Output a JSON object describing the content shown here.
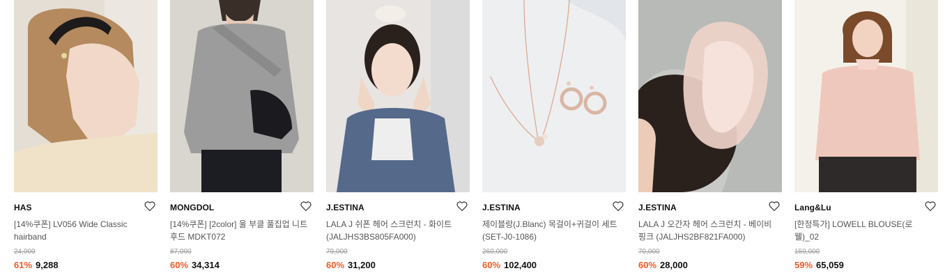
{
  "colors": {
    "discount": "#ef5b24",
    "text": "#111111",
    "muted": "#555555",
    "strike": "#999999"
  },
  "products": [
    {
      "brand": "HAS",
      "name": "[14%쿠폰] LV056 Wide Classic hairband",
      "original_price": "24,000",
      "discount_rate": "61%",
      "price": "9,288",
      "wishlist_icon": "heart-outline-icon"
    },
    {
      "brand": "MONGDOL",
      "name": "[14%쿠폰] [2color] 울 부클 풀집업 니트후드 MDKT072",
      "original_price": "87,000",
      "discount_rate": "60%",
      "price": "34,314",
      "wishlist_icon": "heart-outline-icon"
    },
    {
      "brand": "J.ESTINA",
      "name": "LALA J 쉬폰 헤어 스크런치 - 화이트 (JALJHS3BS805FA000)",
      "original_price": "79,000",
      "discount_rate": "60%",
      "price": "31,200",
      "wishlist_icon": "heart-outline-icon"
    },
    {
      "brand": "J.ESTINA",
      "name": "제이블랑(J.Blanc) 목걸이+귀걸이 세트 (SET-J0-1086)",
      "original_price": "260,000",
      "discount_rate": "60%",
      "price": "102,400",
      "wishlist_icon": "heart-outline-icon"
    },
    {
      "brand": "J.ESTINA",
      "name": "LALA J 오간자 헤어 스크런치 - 베이비 핑크 (JALJHS2BF821FA000)",
      "original_price": "70,000",
      "discount_rate": "60%",
      "price": "28,000",
      "wishlist_icon": "heart-outline-icon"
    },
    {
      "brand": "Lang&Lu",
      "name": "[한정특가] LOWELL BLOUSE(로웰)_02",
      "original_price": "159,000",
      "discount_rate": "59%",
      "price": "65,059",
      "wishlist_icon": "heart-outline-icon"
    }
  ]
}
